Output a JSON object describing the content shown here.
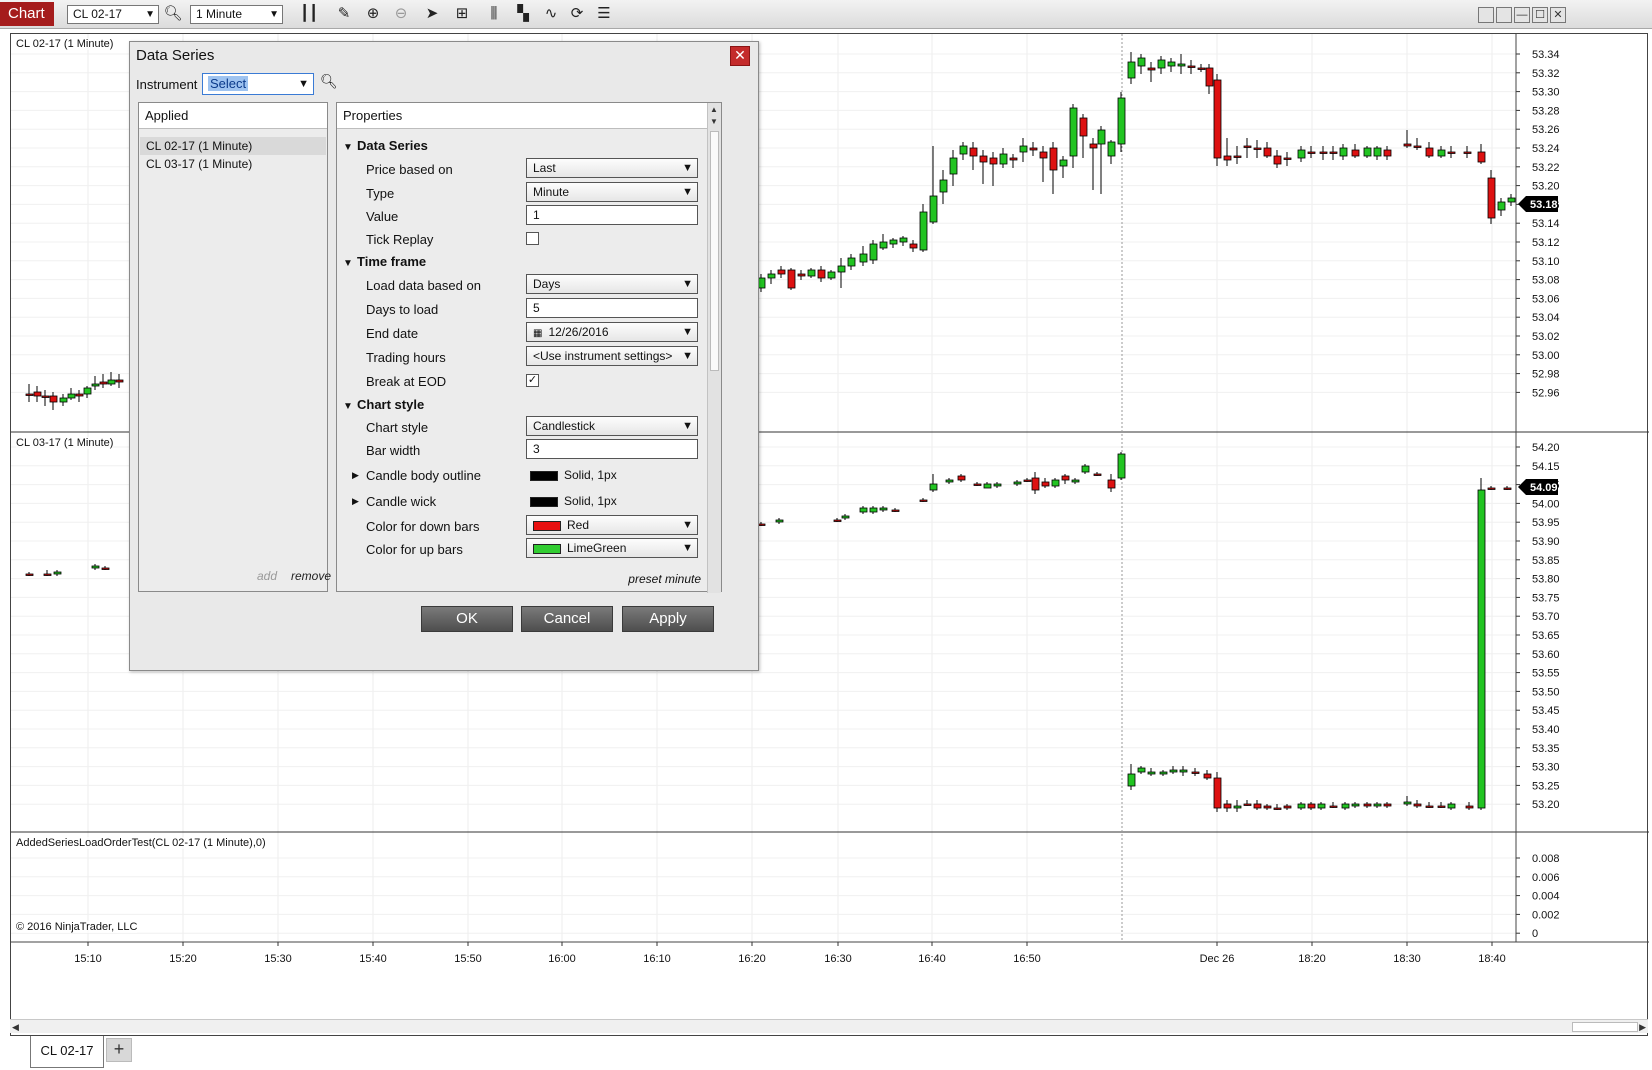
{
  "toolbar": {
    "app_label": "Chart",
    "instrument": "CL 02-17",
    "interval": "1 Minute",
    "icons": [
      "search-icon",
      "bar-type-icon",
      "draw-pencil-icon",
      "zoom-in-icon",
      "zoom-out-icon",
      "pointer-icon",
      "data-box-icon",
      "data-series-icon",
      "strategy-icon",
      "indicators-icon",
      "refresh-icon",
      "properties-list-icon"
    ]
  },
  "chart": {
    "panes": [
      {
        "label": "CL 02-17 (1 Minute)",
        "price_ticks": [
          "53.34",
          "53.32",
          "53.30",
          "53.28",
          "53.26",
          "53.24",
          "53.22",
          "53.20",
          "53.16",
          "53.14",
          "53.12",
          "53.10",
          "53.08",
          "53.06",
          "53.04",
          "53.02",
          "53.00",
          "52.98",
          "52.96"
        ],
        "last_price": "53.18"
      },
      {
        "label": "CL 03-17 (1 Minute)",
        "price_ticks": [
          "54.20",
          "54.15",
          "54.05",
          "54.00",
          "53.95",
          "53.90",
          "53.85",
          "53.80",
          "53.75",
          "53.70",
          "53.65",
          "53.60",
          "53.55",
          "53.50",
          "53.45",
          "53.40",
          "53.35",
          "53.30",
          "53.25",
          "53.20"
        ],
        "last_price": "54.09"
      },
      {
        "label": "AddedSeriesLoadOrderTest(CL 02-17 (1 Minute),0)",
        "price_ticks": [
          "0.008",
          "0.006",
          "0.004",
          "0.002",
          "0"
        ]
      }
    ],
    "time_ticks": [
      "15:10",
      "15:20",
      "15:30",
      "15:40",
      "15:50",
      "16:00",
      "16:10",
      "16:20",
      "16:30",
      "16:40",
      "16:50",
      "Dec 26",
      "18:20",
      "18:30",
      "18:40"
    ],
    "copyright": "© 2016 NinjaTrader, LLC",
    "colors": {
      "up": "#22c422",
      "down": "#dd1111",
      "last_price_bg": "#000000"
    }
  },
  "tabs": {
    "active": "CL 02-17",
    "add_label": "+"
  },
  "dialog": {
    "title": "Data Series",
    "close_label": "✕",
    "instrument_label": "Instrument",
    "instrument_value": "Select",
    "applied": {
      "header": "Applied",
      "items": [
        "CL 02-17 (1 Minute)",
        "CL 03-17 (1 Minute)"
      ],
      "add_label": "add",
      "remove_label": "remove"
    },
    "properties": {
      "header": "Properties",
      "groups": [
        {
          "name": "Data Series",
          "rows": [
            {
              "label": "Price based on",
              "value": "Last"
            },
            {
              "label": "Type",
              "value": "Minute"
            },
            {
              "label": "Value",
              "value": "1"
            },
            {
              "label": "Tick Replay",
              "value": ""
            }
          ]
        },
        {
          "name": "Time frame",
          "rows": [
            {
              "label": "Load data based on",
              "value": "Days"
            },
            {
              "label": "Days to load",
              "value": "5"
            },
            {
              "label": "End date",
              "value": "12/26/2016"
            },
            {
              "label": "Trading hours",
              "value": "<Use instrument settings>"
            },
            {
              "label": "Break at EOD",
              "value": "✓"
            }
          ]
        },
        {
          "name": "Chart style",
          "rows": [
            {
              "label": "Chart style",
              "value": "Candlestick"
            },
            {
              "label": "Bar width",
              "value": "3"
            },
            {
              "label": "Candle body outline",
              "value": "Solid, 1px"
            },
            {
              "label": "Candle wick",
              "value": "Solid, 1px"
            },
            {
              "label": "Color for down bars",
              "value": "Red"
            },
            {
              "label": "Color for up bars",
              "value": "LimeGreen"
            }
          ]
        }
      ],
      "preset_label": "preset minute"
    },
    "buttons": {
      "ok": "OK",
      "cancel": "Cancel",
      "apply": "Apply"
    },
    "colors": {
      "red": "#e81010",
      "limegreen": "#32cd32",
      "black": "#000000"
    }
  }
}
